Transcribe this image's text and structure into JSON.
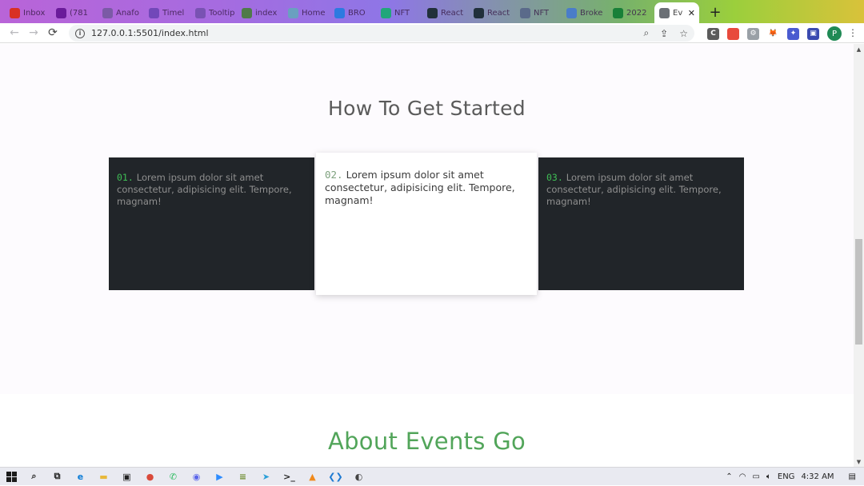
{
  "browser": {
    "tabs": [
      {
        "title": "Inbox",
        "icon": "gmail-icon",
        "color": "#d93025"
      },
      {
        "title": "(781",
        "icon": "mail-icon",
        "color": "#6a1b9a"
      },
      {
        "title": "Anafo",
        "icon": "globe-icon",
        "color": "#7b5aa6"
      },
      {
        "title": "Timel",
        "icon": "forms-icon",
        "color": "#7248b9"
      },
      {
        "title": "Tooltip",
        "icon": "bootstrap-icon",
        "color": "#7952b3"
      },
      {
        "title": "index",
        "icon": "globe-icon",
        "color": "#4f7a4a"
      },
      {
        "title": "Home",
        "icon": "globe-icon",
        "color": "#6aa0c0"
      },
      {
        "title": "BRO",
        "icon": "cloud-icon",
        "color": "#2d7ae0"
      },
      {
        "title": "NFT",
        "icon": "nft-icon",
        "color": "#21a67a"
      },
      {
        "title": "React",
        "icon": "react-icon",
        "color": "#21303b"
      },
      {
        "title": "React",
        "icon": "react-icon",
        "color": "#21303b"
      },
      {
        "title": "NFT",
        "icon": "globe-icon",
        "color": "#5a6a8a"
      },
      {
        "title": "Broke",
        "icon": "chart-icon",
        "color": "#4a7dc9"
      },
      {
        "title": "2022",
        "icon": "sheets-icon",
        "color": "#188038"
      }
    ],
    "active_tab": {
      "title": "Ev",
      "close": "✕"
    },
    "new_tab": "+",
    "url": "127.0.0.1:5501/index.html",
    "profile_initial": "P",
    "extensions": [
      {
        "name": "c-extension-icon",
        "label": "C",
        "color": "#5b5b5b"
      },
      {
        "name": "color-wheel-extension-icon",
        "label": "",
        "color": "#e84a3c"
      },
      {
        "name": "gear-extension-icon",
        "label": "⚙",
        "color": "#9aa0a6"
      },
      {
        "name": "metamask-fox-icon",
        "label": "🦊",
        "color": "#ffffff"
      },
      {
        "name": "puzzle-extensions-icon",
        "label": "✦",
        "color": "#4a5bd0"
      },
      {
        "name": "sidepanel-icon",
        "label": "▣",
        "color": "#3a4ab0"
      }
    ]
  },
  "page": {
    "start_heading": "How To Get Started",
    "steps": [
      {
        "num": "01.",
        "text": "Lorem ipsum dolor sit amet consectetur, adipisicing elit. Tempore, magnam!"
      },
      {
        "num": "02.",
        "text": "Lorem ipsum dolor sit amet consectetur, adipisicing elit. Tempore, magnam!"
      },
      {
        "num": "03.",
        "text": "Lorem ipsum dolor sit amet consectetur, adipisicing elit. Tempore, magnam!"
      }
    ],
    "events_heading": "About Events Go"
  },
  "taskbar": {
    "time": "4:32 AM",
    "language": "ENG",
    "apps": [
      {
        "name": "search-icon",
        "glyph": "⌕",
        "color": "#222222"
      },
      {
        "name": "task-view-icon",
        "glyph": "⧉",
        "color": "#222222"
      },
      {
        "name": "edge-icon",
        "glyph": "e",
        "color": "#0a7bd6"
      },
      {
        "name": "file-explorer-icon",
        "glyph": "▬",
        "color": "#e8b83a"
      },
      {
        "name": "store-icon",
        "glyph": "▣",
        "color": "#222222"
      },
      {
        "name": "chrome-icon",
        "glyph": "●",
        "color": "#d9493a"
      },
      {
        "name": "whatsapp-icon",
        "glyph": "✆",
        "color": "#25b95a"
      },
      {
        "name": "discord-icon",
        "glyph": "◉",
        "color": "#5a65ea"
      },
      {
        "name": "zoom-icon",
        "glyph": "▶",
        "color": "#2d8cff"
      },
      {
        "name": "layers-app-icon",
        "glyph": "≡",
        "color": "#6a8a2a"
      },
      {
        "name": "telegram-icon",
        "glyph": "➤",
        "color": "#2a9fd8"
      },
      {
        "name": "terminal-icon",
        "glyph": ">_",
        "color": "#222222"
      },
      {
        "name": "vlc-icon",
        "glyph": "▲",
        "color": "#f08a1c"
      },
      {
        "name": "vscode-icon",
        "glyph": "❮❯",
        "color": "#1e7ad2"
      },
      {
        "name": "photos-icon",
        "glyph": "◐",
        "color": "#444444"
      }
    ]
  }
}
